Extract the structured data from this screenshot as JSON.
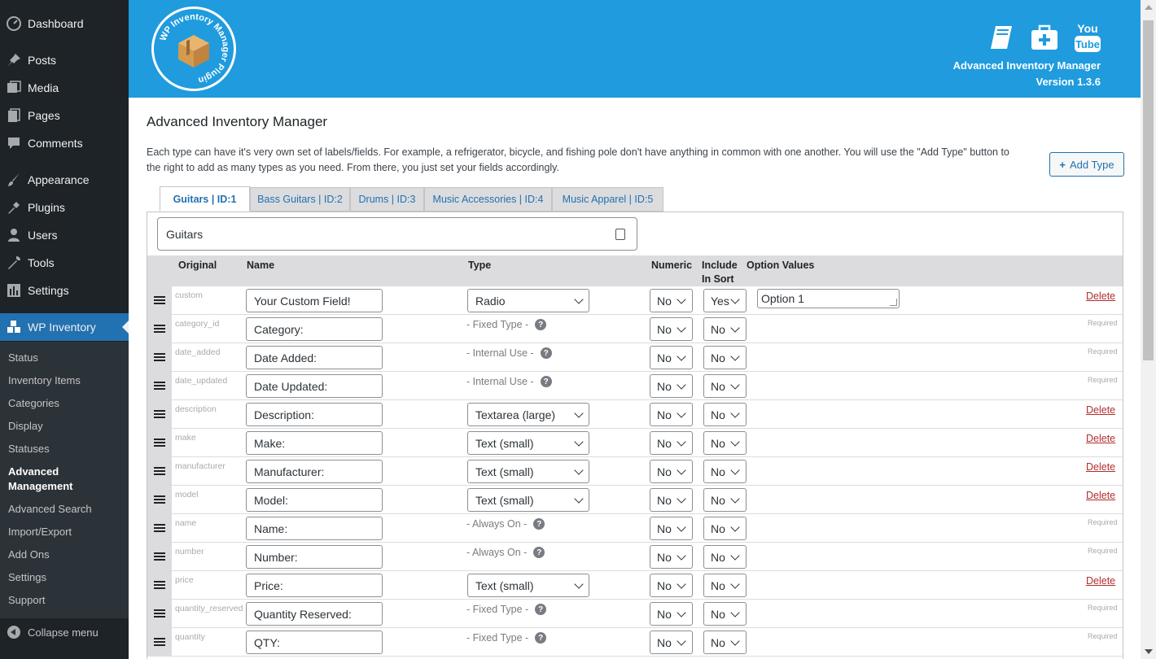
{
  "sidebar": {
    "items": [
      {
        "label": "Dashboard",
        "icon": "dashboard-icon"
      },
      {
        "label": "Posts",
        "icon": "pin-icon"
      },
      {
        "label": "Media",
        "icon": "media-icon"
      },
      {
        "label": "Pages",
        "icon": "pages-icon"
      },
      {
        "label": "Comments",
        "icon": "comments-icon"
      },
      {
        "label": "Appearance",
        "icon": "brush-icon"
      },
      {
        "label": "Plugins",
        "icon": "plug-icon"
      },
      {
        "label": "Users",
        "icon": "users-icon"
      },
      {
        "label": "Tools",
        "icon": "wrench-icon"
      },
      {
        "label": "Settings",
        "icon": "settings-icon"
      },
      {
        "label": "WP Inventory",
        "icon": "inventory-icon"
      }
    ],
    "submenu": [
      "Status",
      "Inventory Items",
      "Categories",
      "Display",
      "Statuses",
      "Advanced Management",
      "Advanced Search",
      "Import/Export",
      "Add Ons",
      "Settings",
      "Support"
    ],
    "collapse_label": "Collapse menu"
  },
  "banner": {
    "logo_text": "WP Inventory Manager Plugin",
    "title": "Advanced Inventory Manager",
    "version": "Version 1.3.6",
    "icons": [
      "manual-icon",
      "support-icon",
      "youtube-icon"
    ],
    "youtube_you": "You",
    "youtube_tube": "Tube"
  },
  "page": {
    "title": "Advanced Inventory Manager",
    "description": "Each type can have it's very own set of labels/fields. For example, a refrigerator, bicycle, and fishing pole don't have anything in common with one another. You will use the \"Add Type\" button to the right to add as many types as you need. From there, you just set your fields accordingly.",
    "add_type_label": "Add Type"
  },
  "tabs": [
    {
      "label": "Guitars | ID:1",
      "active": true
    },
    {
      "label": "Bass Guitars | ID:2",
      "active": false
    },
    {
      "label": "Drums | ID:3",
      "active": false
    },
    {
      "label": "Music Accessories | ID:4",
      "active": false
    },
    {
      "label": "Music Apparel | ID:5",
      "active": false
    }
  ],
  "type_name": "Guitars",
  "table": {
    "headers": {
      "original": "Original",
      "name": "Name",
      "type": "Type",
      "numeric": "Numeric",
      "include_in_sort": "Include In Sort",
      "option_values": "Option Values"
    },
    "rows": [
      {
        "original": "custom",
        "name": "Your Custom Field!",
        "type": "Radio",
        "fixed": "",
        "numeric": "No",
        "sort": "Yes",
        "option": "Option 1",
        "action": "Delete"
      },
      {
        "original": "category_id",
        "name": "Category:",
        "type": "",
        "fixed": "- Fixed Type -",
        "numeric": "No",
        "sort": "No",
        "option": "",
        "action": "Required"
      },
      {
        "original": "date_added",
        "name": "Date Added:",
        "type": "",
        "fixed": "- Internal Use -",
        "numeric": "No",
        "sort": "No",
        "option": "",
        "action": "Required"
      },
      {
        "original": "date_updated",
        "name": "Date Updated:",
        "type": "",
        "fixed": "- Internal Use -",
        "numeric": "No",
        "sort": "No",
        "option": "",
        "action": "Required"
      },
      {
        "original": "description",
        "name": "Description:",
        "type": "Textarea (large)",
        "fixed": "",
        "numeric": "No",
        "sort": "No",
        "option": "",
        "action": "Delete"
      },
      {
        "original": "make",
        "name": "Make:",
        "type": "Text (small)",
        "fixed": "",
        "numeric": "No",
        "sort": "No",
        "option": "",
        "action": "Delete"
      },
      {
        "original": "manufacturer",
        "name": "Manufacturer:",
        "type": "Text (small)",
        "fixed": "",
        "numeric": "No",
        "sort": "No",
        "option": "",
        "action": "Delete"
      },
      {
        "original": "model",
        "name": "Model:",
        "type": "Text (small)",
        "fixed": "",
        "numeric": "No",
        "sort": "No",
        "option": "",
        "action": "Delete"
      },
      {
        "original": "name",
        "name": "Name:",
        "type": "",
        "fixed": "- Always On -",
        "numeric": "No",
        "sort": "No",
        "option": "",
        "action": "Required"
      },
      {
        "original": "number",
        "name": "Number:",
        "type": "",
        "fixed": "- Always On -",
        "numeric": "No",
        "sort": "No",
        "option": "",
        "action": "Required"
      },
      {
        "original": "price",
        "name": "Price:",
        "type": "Text (small)",
        "fixed": "",
        "numeric": "No",
        "sort": "No",
        "option": "",
        "action": "Delete"
      },
      {
        "original": "quantity_reserved",
        "name": "Quantity Reserved:",
        "type": "",
        "fixed": "- Fixed Type -",
        "numeric": "No",
        "sort": "No",
        "option": "",
        "action": "Required"
      },
      {
        "original": "quantity",
        "name": "QTY:",
        "type": "",
        "fixed": "- Fixed Type -",
        "numeric": "No",
        "sort": "No",
        "option": "",
        "action": "Required"
      }
    ]
  },
  "colors": {
    "banner": "#1f9bde",
    "sidebar": "#1d2327",
    "active_menu": "#2271b1",
    "delete": "#b32d2e"
  }
}
